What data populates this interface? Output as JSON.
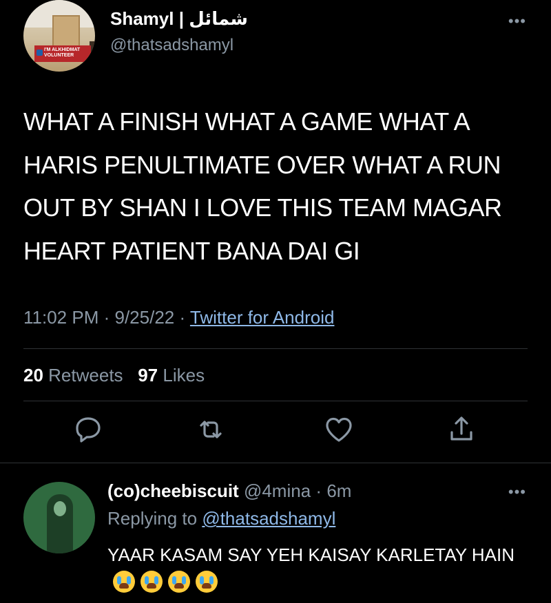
{
  "tweet": {
    "author_name": "Shamyl | شمائل",
    "author_handle": "@thatsadshamyl",
    "avatar_banner_text": "I'M ALKHIDMAT VOLUNTEER",
    "more_icon": "ellipsis-icon",
    "text": "WHAT A FINISH WHAT A GAME WHAT A HARIS PENULTIMATE OVER WHAT A RUN OUT BY SHAN I LOVE THIS TEAM MAGAR HEART PATIENT BANA DAI GI",
    "time": "11:02 PM",
    "date": "9/25/22",
    "source": "Twitter for Android",
    "separator": "·",
    "retweets_count": "20",
    "retweets_label": "Retweets",
    "likes_count": "97",
    "likes_label": "Likes"
  },
  "actions": [
    {
      "name": "reply",
      "icon": "reply-bubble-icon"
    },
    {
      "name": "retweet",
      "icon": "retweet-icon"
    },
    {
      "name": "like",
      "icon": "heart-icon"
    },
    {
      "name": "share",
      "icon": "share-icon"
    }
  ],
  "reply": {
    "author_name": "(co)cheebiscuit",
    "author_handle": "@4mina",
    "time_ago": "6m",
    "separator": "·",
    "replying_prefix": "Replying to",
    "replying_to": "@thatsadshamyl",
    "text": "YAAR KASAM SAY YEH KAISAY KARLETAY HAIN",
    "emoji_icon": "loudly-crying-face-icon",
    "emoji_count": 4
  },
  "colors": {
    "background": "#000000",
    "secondary_text": "#8b98a5",
    "link": "#8fb9e8",
    "divider": "#2f3336"
  }
}
